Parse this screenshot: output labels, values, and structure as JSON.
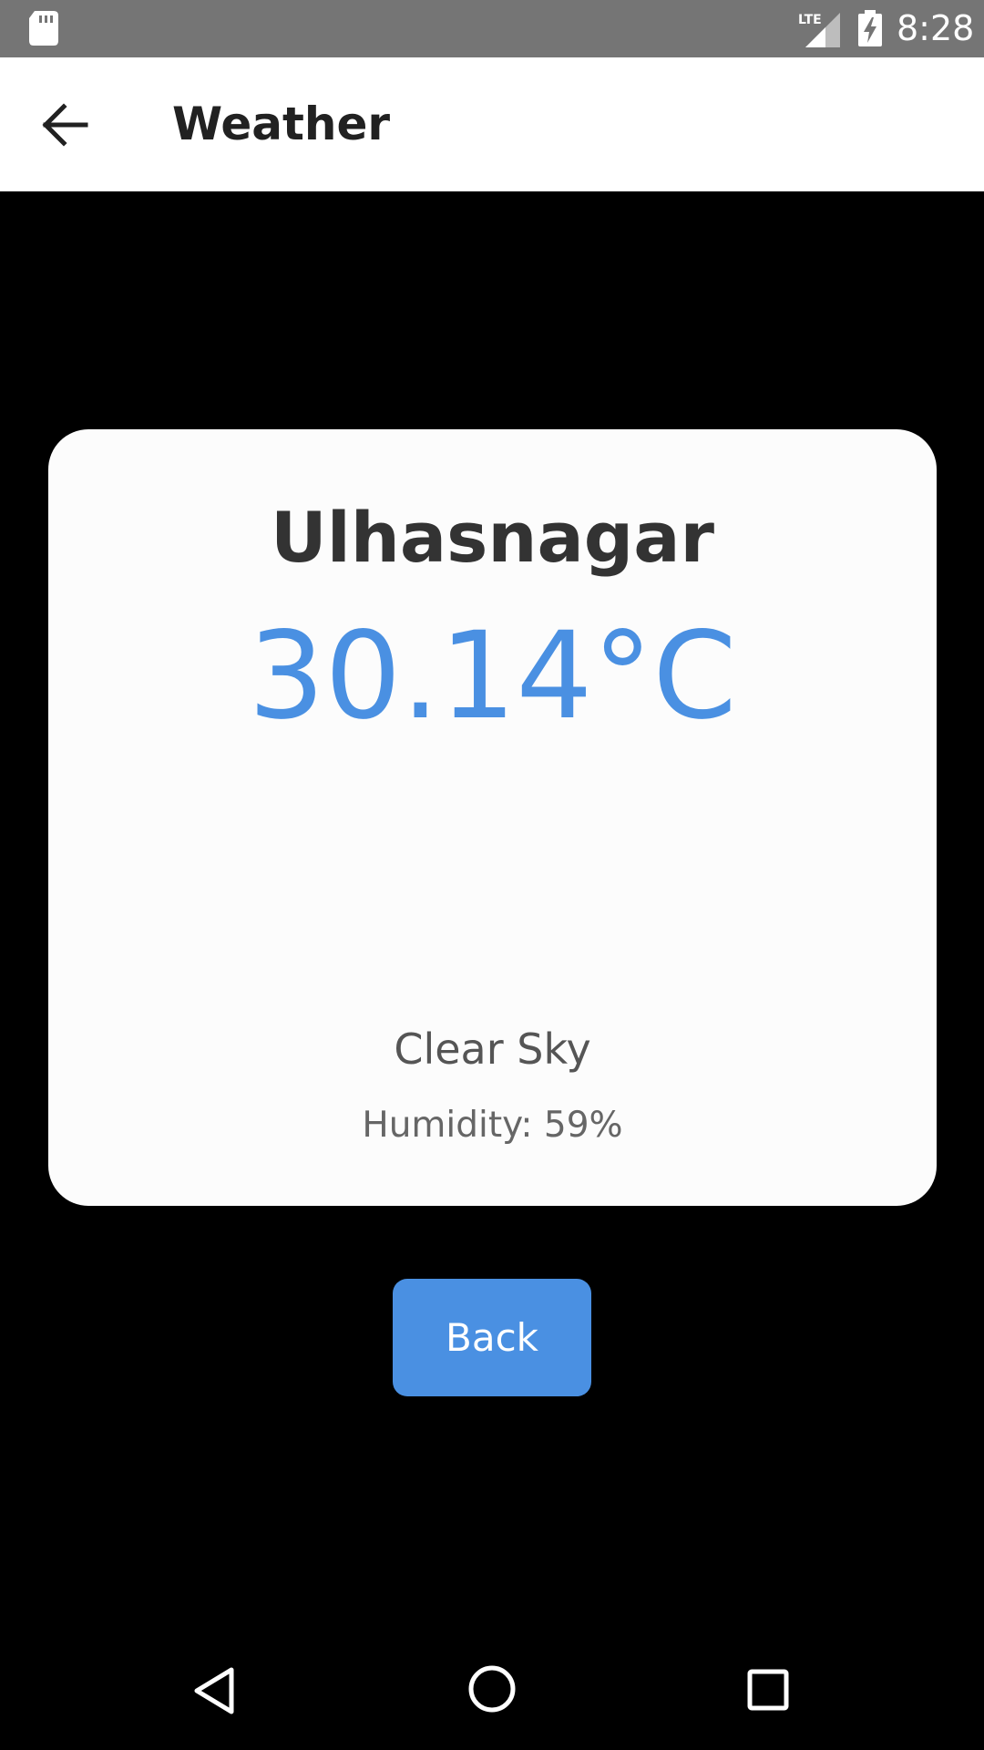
{
  "status_bar": {
    "time": "8:28",
    "network_label": "LTE",
    "icons": [
      "sd-card-icon",
      "lte-signal-icon",
      "battery-charging-icon"
    ]
  },
  "app_bar": {
    "title": "Weather",
    "back_icon": "arrow-left-icon"
  },
  "weather": {
    "city": "Ulhasnagar",
    "temperature": "30.14°C",
    "condition": "Clear Sky",
    "humidity": "Humidity: 59%"
  },
  "actions": {
    "back_label": "Back"
  },
  "nav_bar": {
    "icons": [
      "nav-back-icon",
      "nav-home-icon",
      "nav-recents-icon"
    ]
  },
  "colors": {
    "accent": "#4a90e2",
    "status_bar": "#757575",
    "background": "#000000",
    "card": "#fcfcfc",
    "title_text": "#212121"
  }
}
